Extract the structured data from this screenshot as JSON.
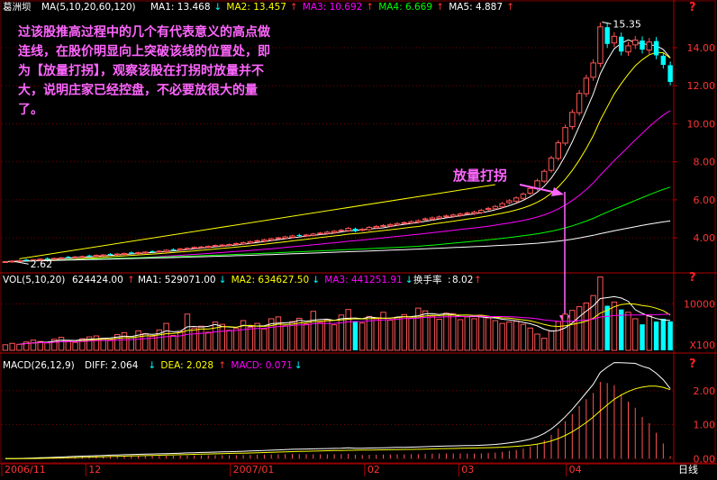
{
  "stock_name": "葛洲坝",
  "price_header": {
    "label": "MA(5,10,20,60,120)",
    "items": [
      {
        "name": "MA1",
        "value": "13.468",
        "arrow": "↓",
        "color": "#ffffff",
        "arrow_color": "#00ffff"
      },
      {
        "name": "MA2",
        "value": "13.457",
        "arrow": "↑",
        "color": "#ffff00",
        "arrow_color": "#ff3333"
      },
      {
        "name": "MA3",
        "value": "10.692",
        "arrow": "↑",
        "color": "#ff00ff",
        "arrow_color": "#ff3333"
      },
      {
        "name": "MA4",
        "value": "6.669",
        "arrow": "↑",
        "color": "#00ff00",
        "arrow_color": "#ff3333"
      },
      {
        "name": "MA5",
        "value": "4.887",
        "arrow": "↑",
        "color": "#ffffff",
        "arrow_color": "#ff3333"
      }
    ]
  },
  "vol_header": {
    "label": "VOL(5,10,20)",
    "value": "624424.00",
    "value_arrow": "↑",
    "items": [
      {
        "name": "MA1",
        "value": "529071.00",
        "arrow": "↓",
        "color": "#ffffff",
        "arrow_color": "#00ffff"
      },
      {
        "name": "MA2",
        "value": "634627.50",
        "arrow": "↓",
        "color": "#ffff00",
        "arrow_color": "#00ffff"
      },
      {
        "name": "MA3",
        "value": "441251.91",
        "arrow": "↓",
        "color": "#ff00ff",
        "arrow_color": "#00ffff"
      }
    ],
    "turnover_label": "换手率",
    "turnover_value": "8.02",
    "turnover_arrow": "↑"
  },
  "macd_header": {
    "label": "MACD(26,12,9)",
    "items": [
      {
        "name": "DIFF",
        "value": "2.064",
        "arrow": "↓",
        "color": "#ffffff",
        "arrow_color": "#00ffff"
      },
      {
        "name": "DEA",
        "value": "2.028",
        "arrow": "↑",
        "color": "#ffff00",
        "arrow_color": "#ff3333"
      },
      {
        "name": "MACD",
        "value": "0.071",
        "arrow": "↓",
        "color": "#ff00ff",
        "arrow_color": "#00ffff"
      }
    ]
  },
  "annotation": {
    "text_lines": [
      "过该股推高过程中的几个有代表意义的高点做",
      "连线，在股价明显向上突破该线的位置处，即",
      "为【放量打拐】，观察该股在打拐时放量并不",
      "大，说明庄家已经控盘，不必要放很大的量",
      "了。"
    ],
    "callout": "放量打拐"
  },
  "question_marks": [
    "?",
    "?",
    "?"
  ],
  "colors": {
    "up": "#ff5555",
    "down": "#00ffff",
    "grid": "#7a0000",
    "axis_text": "#ff3333",
    "trendline": "#ffff00",
    "arrow": "#ff66ff"
  },
  "chart_data": {
    "type": "candlestick",
    "title": "葛洲坝",
    "frequency": "日线",
    "x_ticks": [
      "2006/11",
      "12",
      "2007/01",
      "02",
      "03",
      "04"
    ],
    "price_axis": {
      "ticks": [
        4.0,
        6.0,
        8.0,
        10.0,
        12.0,
        14.0
      ],
      "ylim": [
        2.3,
        15.8
      ],
      "scale": "linear"
    },
    "annotated_high": 15.35,
    "annotated_low": 2.62,
    "trendline": {
      "from_price": 2.9,
      "to_price": 6.8
    },
    "closes": [
      2.75,
      2.78,
      2.8,
      2.82,
      2.85,
      2.88,
      2.9,
      2.92,
      2.95,
      2.98,
      3.0,
      3.02,
      3.05,
      3.08,
      3.1,
      3.12,
      3.15,
      3.18,
      3.2,
      3.22,
      3.25,
      3.28,
      3.3,
      3.35,
      3.38,
      3.42,
      3.45,
      3.5,
      3.52,
      3.55,
      3.6,
      3.62,
      3.65,
      3.7,
      3.75,
      3.8,
      3.85,
      3.9,
      3.95,
      4.0,
      4.05,
      4.1,
      4.12,
      4.15,
      4.2,
      4.25,
      4.3,
      4.35,
      4.4,
      4.5,
      4.35,
      4.45,
      4.55,
      4.6,
      4.65,
      4.7,
      4.75,
      4.8,
      4.85,
      4.9,
      5.0,
      5.05,
      5.1,
      5.15,
      5.2,
      5.25,
      5.3,
      5.35,
      5.45,
      5.55,
      5.65,
      5.8,
      5.95,
      6.1,
      6.3,
      6.6,
      7.0,
      7.5,
      8.2,
      9.0,
      9.8,
      10.6,
      11.6,
      12.4,
      13.2,
      15.1,
      14.2,
      14.6,
      13.8,
      14.1,
      14.4,
      13.9,
      14.3,
      13.6,
      13.1,
      12.2
    ],
    "ma_lines": [
      {
        "name": "MA1",
        "color": "#ffffff",
        "last": 13.468
      },
      {
        "name": "MA2",
        "color": "#ffff00",
        "last": 13.457
      },
      {
        "name": "MA3",
        "color": "#ff00ff",
        "last": 10.692
      },
      {
        "name": "MA4",
        "color": "#00ff00",
        "last": 6.669
      },
      {
        "name": "MA5",
        "color": "#ffffff",
        "last": 4.887
      }
    ],
    "volume_axis": {
      "ticks": [
        10000
      ],
      "unit": "X100",
      "ylim": [
        0,
        13000
      ]
    },
    "volumes": [
      1200,
      1500,
      1300,
      1800,
      2200,
      1900,
      1600,
      2400,
      2800,
      2100,
      1700,
      2500,
      2900,
      3100,
      2600,
      2300,
      3400,
      3800,
      2700,
      4200,
      3600,
      3000,
      4400,
      5800,
      3200,
      4100,
      7800,
      4800,
      5200,
      3900,
      6100,
      5600,
      4300,
      4700,
      6400,
      5000,
      5800,
      4600,
      6800,
      7200,
      5300,
      6200,
      6900,
      5700,
      8400,
      6000,
      6600,
      5500,
      7600,
      8800,
      6300,
      5900,
      7300,
      6800,
      8200,
      6500,
      7100,
      7700,
      6900,
      9100,
      8500,
      7400,
      6700,
      8000,
      7900,
      6600,
      7200,
      6800,
      7500,
      7000,
      6400,
      5800,
      6100,
      6300,
      5600,
      4800,
      3500,
      2600,
      4200,
      6200,
      7800,
      8600,
      9400,
      10200,
      11800,
      15800,
      9600,
      10400,
      8800,
      8200,
      6800,
      5600,
      7400,
      6200,
      6800,
      6244
    ],
    "macd_axis": {
      "ticks": [
        0.0,
        1.0,
        2.0
      ],
      "ylim": [
        -0.15,
        2.55
      ]
    },
    "diff_last": 2.064,
    "dea_last": 2.028,
    "macd_last": 0.071
  }
}
